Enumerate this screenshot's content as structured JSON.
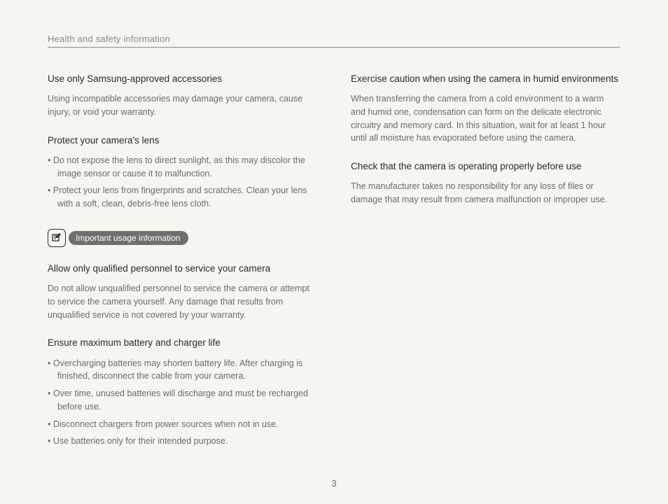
{
  "header": {
    "running_title": "Health and safety information"
  },
  "page_number": "3",
  "left": {
    "sec1": {
      "heading": "Use only Samsung-approved accessories",
      "body": "Using incompatible accessories may damage your camera, cause injury, or void your warranty."
    },
    "sec2": {
      "heading": "Protect your camera's lens",
      "bullets": [
        "Do not expose the lens to direct sunlight, as this may discolor the image sensor or cause it to malfunction.",
        "Protect your lens from fingerprints and scratches. Clean your lens with a soft, clean, debris-free lens cloth."
      ]
    },
    "callout_label": "Important usage information",
    "sec3": {
      "heading": "Allow only qualified personnel to service your camera",
      "body": "Do not allow unqualified personnel to service the camera or attempt to service the camera yourself. Any damage that results from unqualified service is not covered by your warranty."
    },
    "sec4": {
      "heading": "Ensure maximum battery and charger life",
      "bullets": [
        "Overcharging batteries may shorten battery life. After charging is finished, disconnect the cable from your camera.",
        "Over time, unused batteries will discharge and must be recharged before use.",
        "Disconnect chargers from power sources when not in use.",
        "Use batteries only for their intended purpose."
      ]
    }
  },
  "right": {
    "sec1": {
      "heading": "Exercise caution when using the camera in humid environments",
      "body": "When transferring the camera from a cold environment to a warm and humid one, condensation can form on the delicate electronic circuitry and memory card. In this situation, wait for at least 1 hour until all moisture has evaporated before using the camera."
    },
    "sec2": {
      "heading": "Check that the camera is operating properly before use",
      "body": "The manufacturer takes no responsibility for any loss of files or damage that may result from camera malfunction or improper use."
    }
  }
}
